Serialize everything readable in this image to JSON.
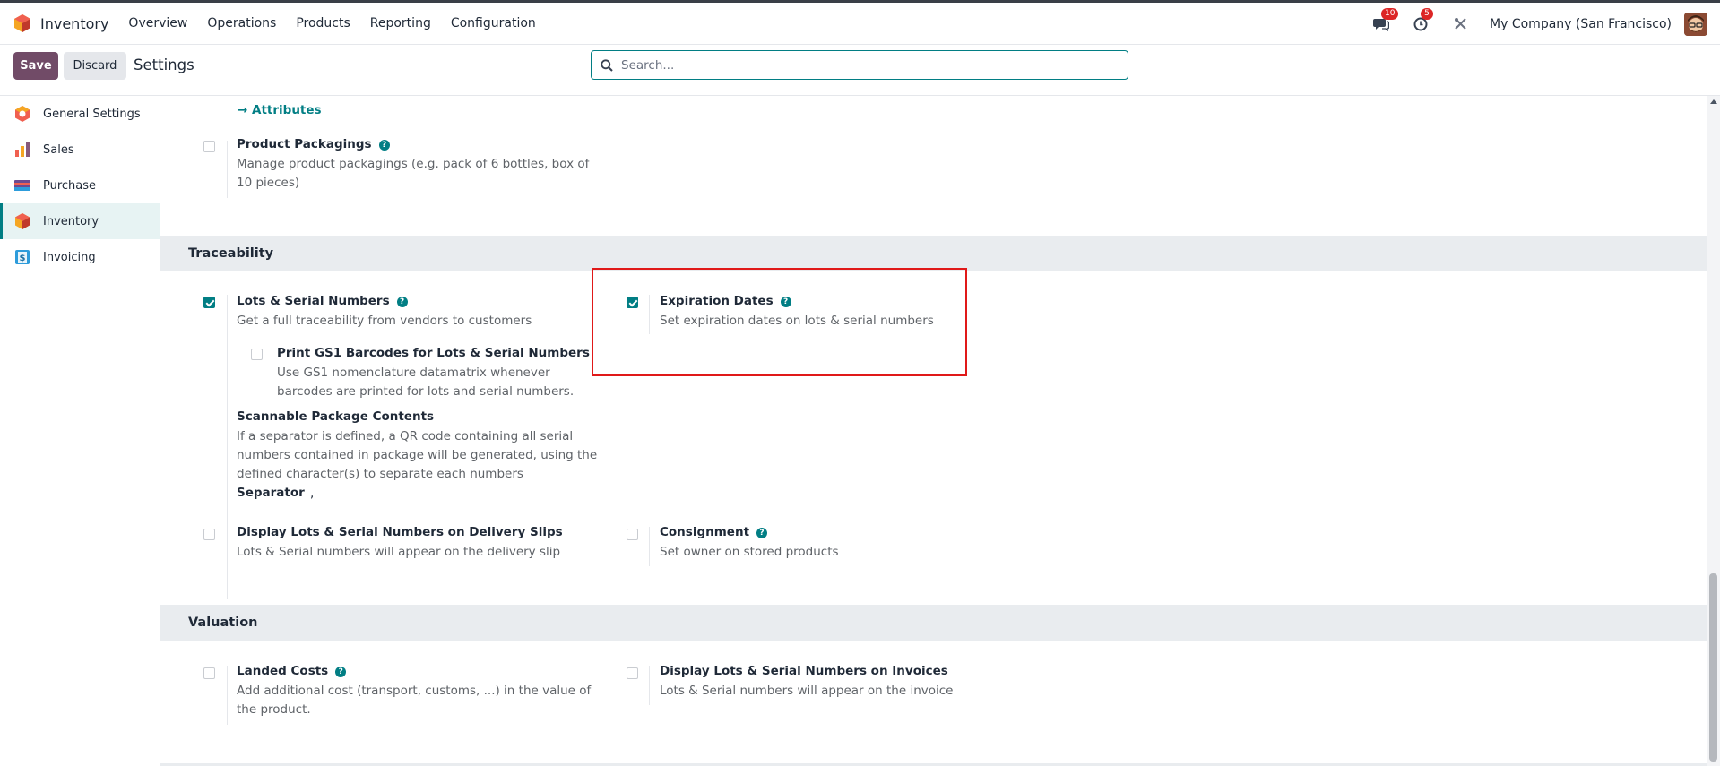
{
  "topbar": {
    "app_name": "Inventory",
    "nav": [
      "Overview",
      "Operations",
      "Products",
      "Reporting",
      "Configuration"
    ],
    "messages_badge": "10",
    "activities_badge": "5",
    "company": "My Company (San Francisco)"
  },
  "control": {
    "save_label": "Save",
    "discard_label": "Discard",
    "title": "Settings",
    "search_placeholder": "Search..."
  },
  "sidebar": {
    "items": [
      {
        "label": "General Settings",
        "icon": "odoo-icon"
      },
      {
        "label": "Sales",
        "icon": "sales-icon"
      },
      {
        "label": "Purchase",
        "icon": "purchase-icon"
      },
      {
        "label": "Inventory",
        "icon": "inventory-icon",
        "active": true
      },
      {
        "label": "Invoicing",
        "icon": "invoicing-icon"
      }
    ]
  },
  "products_section": {
    "attributes_link": "Attributes",
    "packagings": {
      "title": "Product Packagings",
      "desc": "Manage product packagings (e.g. pack of 6 bottles, box of 10 pieces)",
      "checked": false
    }
  },
  "traceability": {
    "header": "Traceability",
    "lots": {
      "title": "Lots & Serial Numbers",
      "desc": "Get a full traceability from vendors to customers",
      "checked": true
    },
    "gs1": {
      "title": "Print GS1 Barcodes for Lots & Serial Numbers",
      "desc": "Use GS1 nomenclature datamatrix whenever barcodes are printed for lots and serial numbers.",
      "checked": false
    },
    "scannable": {
      "title": "Scannable Package Contents",
      "desc": "If a separator is defined, a QR code containing all serial numbers contained in package will be generated, using the defined character(s) to separate each numbers",
      "separator_label": "Separator",
      "separator_value": ","
    },
    "expiration": {
      "title": "Expiration Dates",
      "desc": "Set expiration dates on lots & serial numbers",
      "checked": true
    },
    "delivery_slips": {
      "title": "Display Lots & Serial Numbers on Delivery Slips",
      "desc": "Lots & Serial numbers will appear on the delivery slip",
      "checked": false
    },
    "consignment": {
      "title": "Consignment",
      "desc": "Set owner on stored products",
      "checked": false
    }
  },
  "valuation": {
    "header": "Valuation",
    "landed": {
      "title": "Landed Costs",
      "desc": "Add additional cost (transport, customs, ...) in the value of the product.",
      "checked": false
    },
    "invoices": {
      "title": "Display Lots & Serial Numbers on Invoices",
      "desc": "Lots & Serial numbers will appear on the invoice",
      "checked": false
    }
  },
  "colors": {
    "primary": "#714b67",
    "accent": "#017e84",
    "highlight": "#e01919"
  }
}
